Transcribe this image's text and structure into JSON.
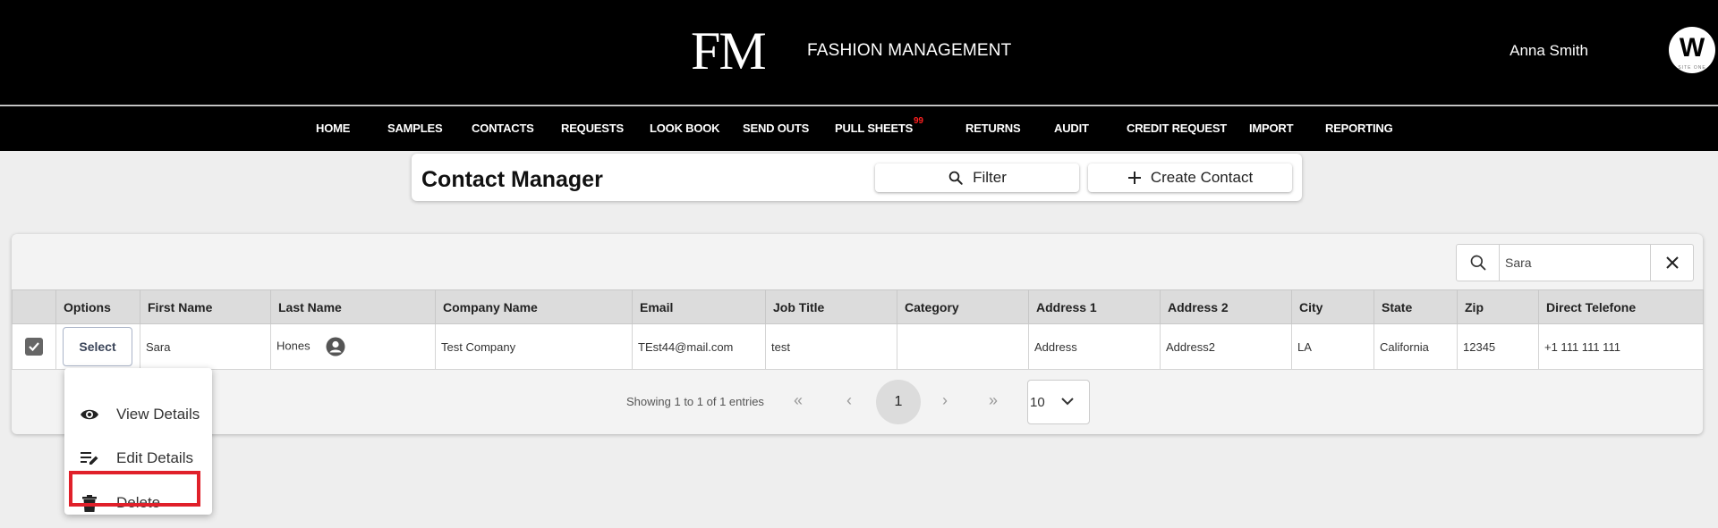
{
  "header": {
    "logo": "FM",
    "brand": "FASHION MANAGEMENT",
    "user_name": "Anna Smith",
    "avatar_letter": "W",
    "avatar_sub": "SITE ONE"
  },
  "nav": {
    "items": [
      "HOME",
      "SAMPLES",
      "CONTACTS",
      "REQUESTS",
      "LOOK BOOK",
      "SEND OUTS",
      "PULL SHEETS",
      "RETURNS",
      "AUDIT",
      "CREDIT REQUEST",
      "IMPORT",
      "REPORTING"
    ],
    "pull_sheets_badge": "99"
  },
  "contact_manager": {
    "title": "Contact Manager",
    "filter_label": "Filter",
    "create_label": "Create Contact"
  },
  "search": {
    "value": "Sara"
  },
  "table": {
    "columns": [
      "Options",
      "First Name",
      "Last Name",
      "Company Name",
      "Email",
      "Job Title",
      "Category",
      "Address 1",
      "Address 2",
      "City",
      "State",
      "Zip",
      "Direct Telefone"
    ],
    "select_label": "Select",
    "row": {
      "first_name": "Sara",
      "last_name": "Hones",
      "company": "Test Company",
      "email": "TEst44@mail.com",
      "job_title": "test",
      "category": "",
      "address1": "Address",
      "address2": "Address2",
      "city": "LA",
      "state": "California",
      "zip": "12345",
      "phone": "+1 111 111 111"
    }
  },
  "pagination": {
    "info": "Showing 1 to 1 of 1 entries",
    "current_page": "1",
    "page_size": "10"
  },
  "menu": {
    "view": "View Details",
    "edit": "Edit Details",
    "delete": "Delete"
  },
  "colors": {
    "header_bg": "#000000",
    "badge": "#ff2020",
    "highlight": "#e0202a"
  }
}
